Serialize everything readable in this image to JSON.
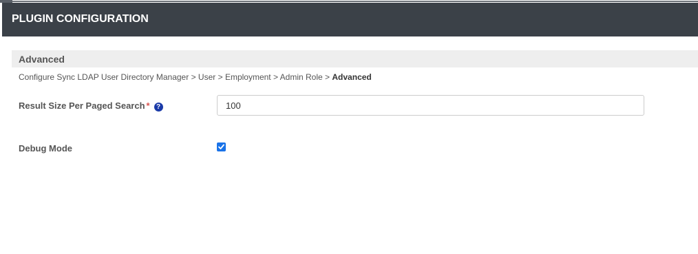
{
  "header": {
    "title": "PLUGIN CONFIGURATION"
  },
  "section": {
    "title": "Advanced"
  },
  "breadcrumb": {
    "items": [
      "Configure Sync LDAP User Directory Manager",
      "User",
      "Employment",
      "Admin Role"
    ],
    "separator": ">",
    "current": "Advanced"
  },
  "fields": {
    "result_size": {
      "label": "Result Size Per Paged Search",
      "required_marker": "*",
      "help_icon": "question-circle-icon",
      "value": "100"
    },
    "debug_mode": {
      "label": "Debug Mode",
      "checked": true
    }
  },
  "colors": {
    "header_bg": "#3b4148",
    "section_bg": "#eeeeee",
    "checkbox_accent": "#1a73e8",
    "required": "#d9534f",
    "help_icon": "#1a3aa8"
  }
}
